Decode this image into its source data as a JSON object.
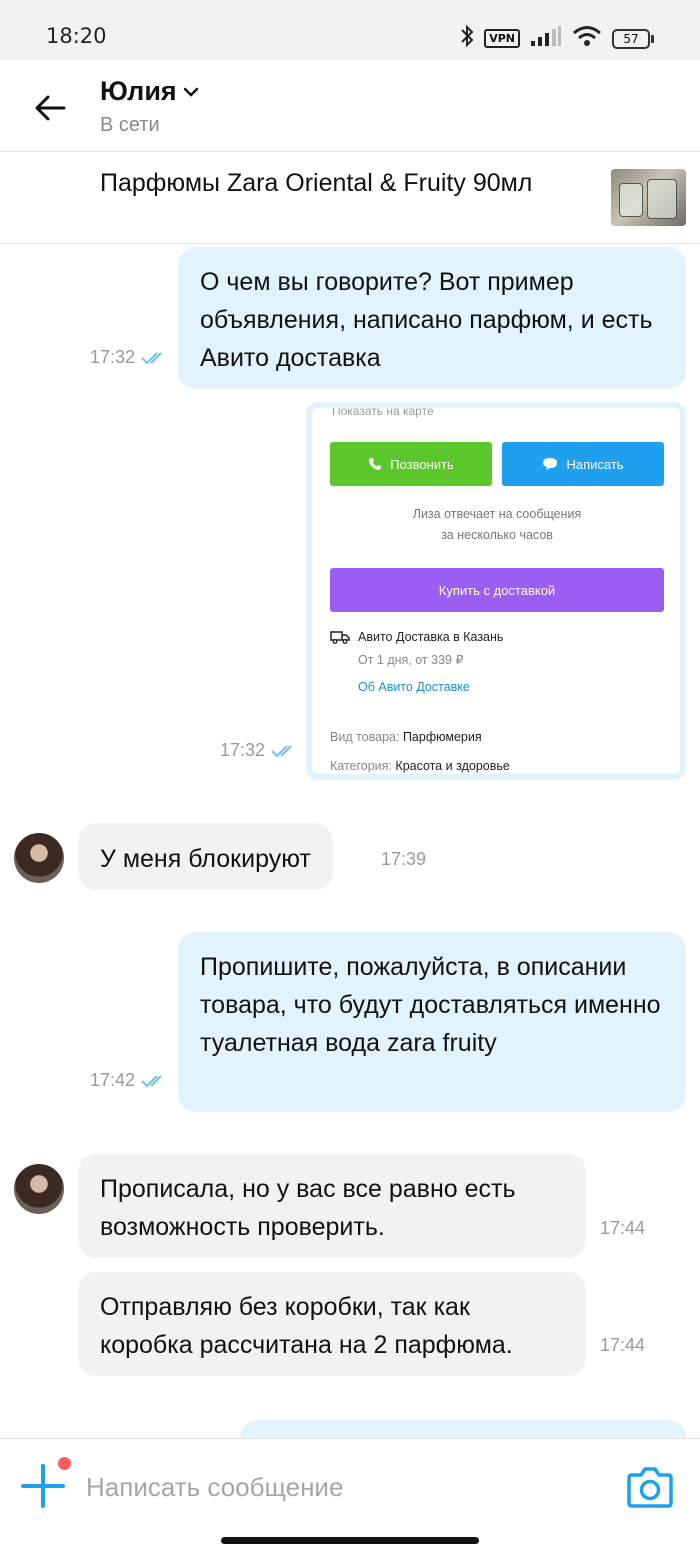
{
  "status_bar": {
    "time": "18:20",
    "vpn_label": "VPN",
    "battery": "57",
    "icons": [
      "bluetooth-icon",
      "vpn-icon",
      "signal-icon",
      "wifi-icon",
      "battery-icon"
    ]
  },
  "header": {
    "name": "Юлия",
    "status": "В сети"
  },
  "listing": {
    "title": "Парфюмы Zara Oriental & Fruity 90мл"
  },
  "messages": {
    "m1": {
      "text": "О чем вы говорите? Вот пример объявления, написано парфюм, и есть Авито доставка",
      "time": "17:32"
    },
    "m2": {
      "time": "17:32",
      "image": {
        "top_text": "Показать на карте",
        "call": "Позвонить",
        "write": "Написать",
        "reply_line1": "Лиза отвечает на сообщения",
        "reply_line2": "за несколько часов",
        "buy": "Купить с доставкой",
        "delivery": "Авито Доставка в Казань",
        "delivery_sub": "От 1 дня, от 339 ₽",
        "delivery_link": "Об Авито Доставке",
        "type_label": "Вид товара:",
        "type_value": "Парфюмерия",
        "category_label": "Категория:",
        "category_value": "Красота и здоровье"
      }
    },
    "m3": {
      "text": "У меня блокируют",
      "time": "17:39"
    },
    "m4": {
      "text": "Пропишите, пожалуйста, в описании товара, что будут доставляться именно туалетная вода zara fruity",
      "time": "17:42"
    },
    "m5": {
      "text": "Прописала, но у вас все равно есть возможность проверить.",
      "time": "17:44"
    },
    "m6": {
      "text": "Отправляю без коробки, так как коробка рассчитана на 2 парфюма.",
      "time": "17:44"
    }
  },
  "composer": {
    "placeholder": "Написать сообщение"
  },
  "colors": {
    "accent": "#1ea0ef",
    "outgoing_bubble": "#e3f3fd",
    "incoming_bubble": "#f2f2f2",
    "notification_dot": "#ff5b61",
    "call_green": "#5cc72a",
    "buy_purple": "#9b5df2"
  }
}
